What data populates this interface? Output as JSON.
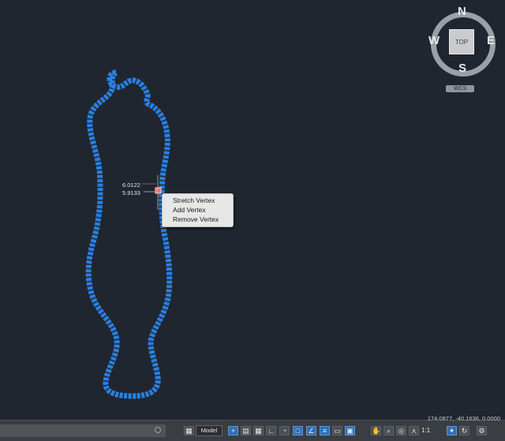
{
  "viewcube": {
    "north": "N",
    "south": "S",
    "east": "E",
    "west": "W",
    "face": "TOP",
    "ucs": "WCS"
  },
  "dimensions": {
    "value_1": "6.0122",
    "value_2": "5.9133"
  },
  "context_menu": {
    "items": [
      "Stretch Vertex",
      "Add Vertex",
      "Remove Vertex"
    ]
  },
  "statusbar": {
    "coordinates": "174.0877, -40.1636, 0.0000",
    "model_tab": "Model",
    "scale": "1:1"
  },
  "colors": {
    "canvas": "#1f2630",
    "shape": "#2a7fe0",
    "grip": "#ff6b6b",
    "menu_bg": "#e7e7e7"
  },
  "icons": [
    "snap-icon",
    "grid-icon",
    "grid-display-icon",
    "ortho-icon",
    "polar-icon",
    "osnap-icon",
    "otrack-icon",
    "lineweight-icon",
    "transparency-icon",
    "selection-cycling-icon",
    "pan-icon",
    "zoom-icon",
    "orbit-icon",
    "annotation-scale-icon",
    "annotation-visibility-icon",
    "workspace-icon"
  ]
}
